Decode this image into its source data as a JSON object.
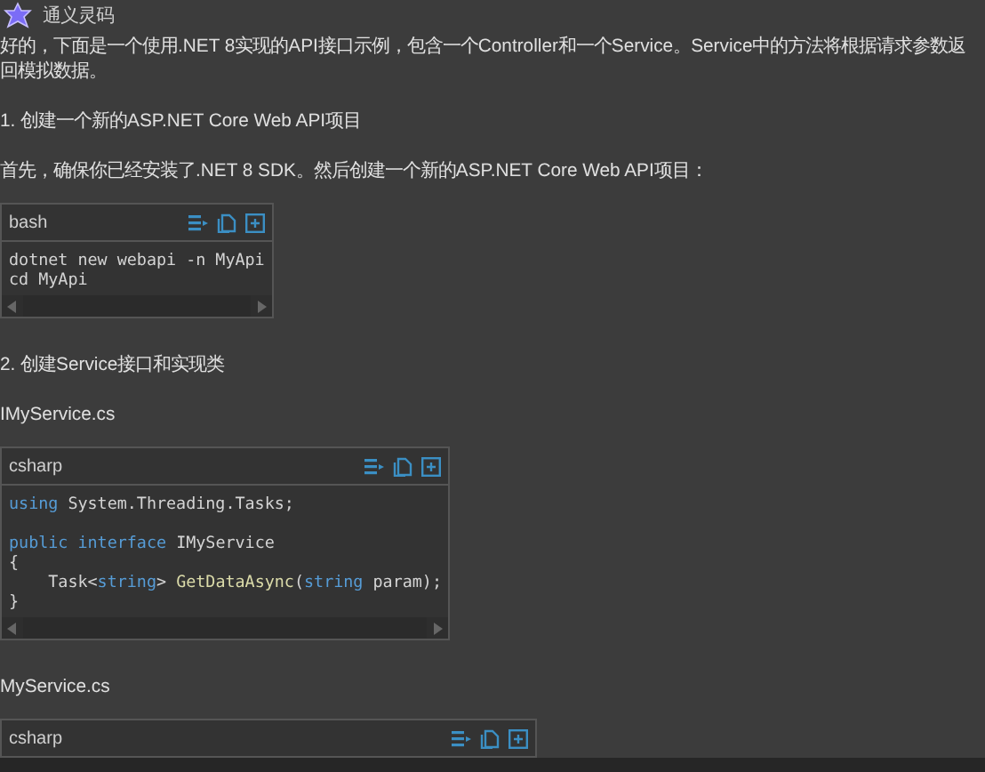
{
  "header": {
    "title": "通义灵码"
  },
  "content": [
    {
      "kind": "text",
      "text": "好的，下面是一个使用.NET 8实现的API接口示例，包含一个Controller和一个Service。Service中的方法将根据请求参数返回模拟数据。"
    },
    {
      "kind": "text",
      "text": "1. 创建一个新的ASP.NET Core Web API项目"
    },
    {
      "kind": "text",
      "text": "首先，确保你已经安装了.NET 8 SDK。然后创建一个新的ASP.NET Core Web API项目："
    },
    {
      "kind": "code",
      "language": "bash",
      "lines": [
        {
          "kind": "code",
          "tokens": [
            {
              "kind": "plain",
              "text": "dotnet new webapi -n MyApi"
            }
          ]
        },
        {
          "kind": "code",
          "tokens": [
            {
              "kind": "plain",
              "text": "cd MyApi"
            }
          ]
        }
      ]
    },
    {
      "kind": "text",
      "text": "2. 创建Service接口和实现类"
    },
    {
      "kind": "text",
      "text": "IMyService.cs"
    },
    {
      "kind": "code",
      "language": "csharp",
      "lines": [
        {
          "kind": "code",
          "tokens": [
            {
              "kind": "keyword",
              "text": "using"
            },
            {
              "kind": "plain",
              "text": " System.Threading.Tasks;"
            }
          ]
        },
        {
          "kind": "blank"
        },
        {
          "kind": "code",
          "tokens": [
            {
              "kind": "keyword",
              "text": "public "
            },
            {
              "kind": "keyword",
              "text": "interface"
            },
            {
              "kind": "plain",
              "text": " IMyService"
            }
          ]
        },
        {
          "kind": "code",
          "tokens": [
            {
              "kind": "plain",
              "text": "{"
            }
          ]
        },
        {
          "kind": "code",
          "tokens": [
            {
              "kind": "plain",
              "text": "    Task<"
            },
            {
              "kind": "keyword",
              "text": "string"
            },
            {
              "kind": "plain",
              "text": "> "
            },
            {
              "kind": "method",
              "text": "GetDataAsync"
            },
            {
              "kind": "plain",
              "text": "("
            },
            {
              "kind": "keyword",
              "text": "string"
            },
            {
              "kind": "plain",
              "text": " param);"
            }
          ]
        },
        {
          "kind": "code",
          "tokens": [
            {
              "kind": "plain",
              "text": "}"
            }
          ]
        }
      ]
    },
    {
      "kind": "text",
      "text": "MyService.cs"
    },
    {
      "kind": "code",
      "language": "csharp"
    }
  ]
}
